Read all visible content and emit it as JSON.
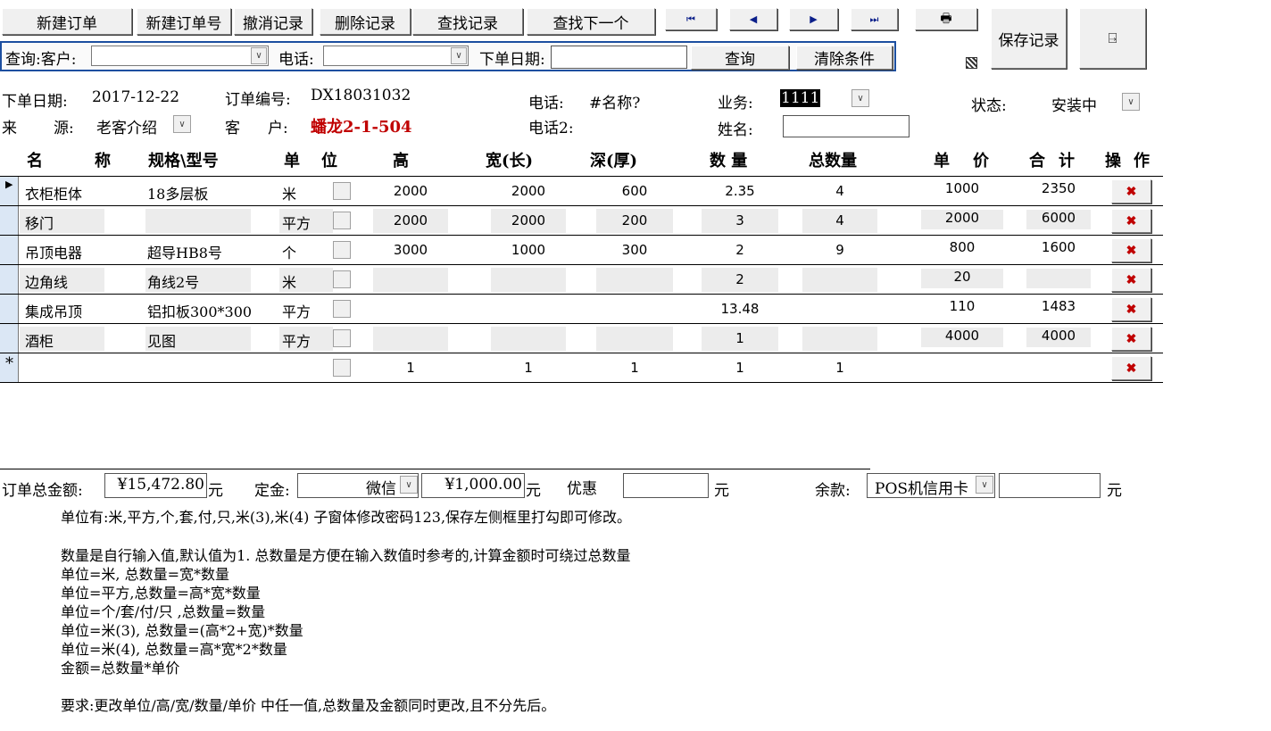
{
  "toolbar": {
    "new_order": "新建订单",
    "new_order_no": "新建订单号",
    "undo": "撤消记录",
    "delete": "删除记录",
    "find": "查找记录",
    "find_next": "查找下一个",
    "save": "保存记录",
    "first_icon": "⏮",
    "prev_icon": "◀",
    "next_icon": "▶",
    "last_icon": "⏭",
    "print_icon": "🖶",
    "exit_icon": "⍈"
  },
  "query": {
    "customer_label": "查询:客户:",
    "phone_label": "电话:",
    "date_label": "下单日期:",
    "query_button": "查询",
    "clear_button": "清除条件",
    "customer_value": "",
    "phone_value": "",
    "date_value": ""
  },
  "order": {
    "date_label": "下单日期:",
    "date_value": "2017-12-22",
    "no_label": "订单编号:",
    "no_value": "DX18031032",
    "phone_label": "电话:",
    "phone_value": "#名称?",
    "sales_label": "业务:",
    "sales_value": "1111",
    "status_label": "状态:",
    "status_value": "安装中",
    "source_label_1": "来",
    "source_label_2": "源:",
    "source_value": "老客介绍",
    "customer_label_1": "客",
    "customer_label_2": "户:",
    "customer_value": "蟠龙2-1-504",
    "phone2_label": "电话2:",
    "phone2_value": "",
    "name_label": "姓名:",
    "name_value": ""
  },
  "table": {
    "headers": {
      "name_1": "名",
      "name_2": "称",
      "spec": "规格\\型号",
      "unit_1": "单",
      "unit_2": "位",
      "height": "高",
      "width": "宽(长)",
      "depth": "深(厚)",
      "qty": "数 量",
      "total_qty": "总数量",
      "price_1": "单",
      "price_2": "价",
      "sum_1": "合",
      "sum_2": "计",
      "op_1": "操",
      "op_2": "作"
    },
    "rows": [
      {
        "name": "衣柜柜体",
        "spec": "18多层板",
        "unit": "米",
        "height": "2000",
        "width": "2000",
        "depth": "600",
        "qty": "2.35",
        "total": "4",
        "price": "1000",
        "sum": "2350"
      },
      {
        "name": "移门",
        "spec": "",
        "unit": "平方",
        "height": "2000",
        "width": "2000",
        "depth": "200",
        "qty": "3",
        "total": "4",
        "price": "2000",
        "sum": "6000"
      },
      {
        "name": "吊顶电器",
        "spec": "超导HB8号",
        "unit": "个",
        "height": "3000",
        "width": "1000",
        "depth": "300",
        "qty": "2",
        "total": "9",
        "price": "800",
        "sum": "1600"
      },
      {
        "name": "边角线",
        "spec": "角线2号",
        "unit": "米",
        "height": "",
        "width": "",
        "depth": "",
        "qty": "2",
        "total": "",
        "price": "20",
        "sum": ""
      },
      {
        "name": "集成吊顶",
        "spec": "铝扣板300*300",
        "unit": "平方",
        "height": "",
        "width": "",
        "depth": "",
        "qty": "13.48",
        "total": "",
        "price": "110",
        "sum": "1483"
      },
      {
        "name": "酒柜",
        "spec": "见图",
        "unit": "平方",
        "height": "",
        "width": "",
        "depth": "",
        "qty": "1",
        "total": "",
        "price": "4000",
        "sum": "4000"
      }
    ],
    "new_row": {
      "marker": "*",
      "height": "1",
      "width": "1",
      "depth": "1",
      "qty": "1",
      "total": "1"
    },
    "current_marker": "▶",
    "delete_icon": "✖"
  },
  "totals": {
    "total_label": "订单总金额:",
    "total_value": "¥15,472.80",
    "yuan": "元",
    "deposit_label": "定金:",
    "deposit_method": "微信",
    "deposit_value": "¥1,000.00",
    "discount_label": "优惠",
    "discount_value": "",
    "balance_label": "余款:",
    "balance_method": "POS机信用卡",
    "balance_value": ""
  },
  "notes": {
    "line1": "单位有:米,平方,个,套,付,只,米(3),米(4)     子窗体修改密码123,保存左侧框里打勾即可修改。",
    "line2": "数量是自行输入值,默认值为1.     总数量是方便在输入数值时参考的,计算金额时可绕过总数量",
    "line3": "单位=米,    总数量=宽*数量",
    "line4": "单位=平方,总数量=高*宽*数量",
    "line5": "单位=个/套/付/只 ,总数量=数量",
    "line6": "单位=米(3),   总数量=(高*2+宽)*数量",
    "line7": "单位=米(4),    总数量=高*宽*2*数量",
    "line8": "金额=总数量*单价",
    "line9": "要求:更改单位/高/宽/数量/单价  中任一值,总数量及金额同时更改,且不分先后。"
  },
  "colors": {
    "accent_customer": "#c00000",
    "query_bar_border": "#1c4fa0",
    "selector_bg": "#dbe7f5"
  }
}
